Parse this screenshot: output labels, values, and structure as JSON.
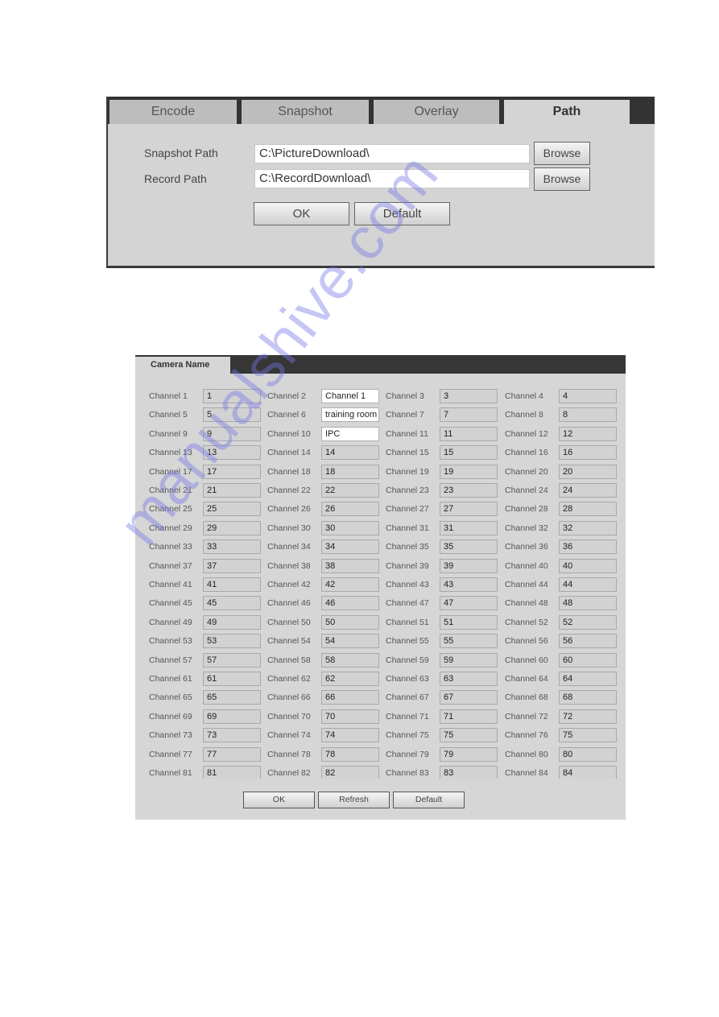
{
  "path_panel": {
    "tabs": [
      {
        "label": "Encode",
        "active": false
      },
      {
        "label": "Snapshot",
        "active": false
      },
      {
        "label": "Overlay",
        "active": false
      },
      {
        "label": "Path",
        "active": true
      }
    ],
    "snapshot_path": {
      "label": "Snapshot Path",
      "value": "C:\\PictureDownload\\",
      "browse_label": "Browse"
    },
    "record_path": {
      "label": "Record Path",
      "value": "C:\\RecordDownload\\",
      "browse_label": "Browse"
    },
    "ok_label": "OK",
    "default_label": "Default"
  },
  "camera_panel": {
    "tab_label": "Camera Name",
    "channels": [
      {
        "label": "Channel 1",
        "value": "1",
        "editable": false
      },
      {
        "label": "Channel 2",
        "value": "Channel 1",
        "editable": true
      },
      {
        "label": "Channel 3",
        "value": "3",
        "editable": false
      },
      {
        "label": "Channel 4",
        "value": "4",
        "editable": false
      },
      {
        "label": "Channel 5",
        "value": "5",
        "editable": false
      },
      {
        "label": "Channel 6",
        "value": "training room",
        "editable": true
      },
      {
        "label": "Channel 7",
        "value": "7",
        "editable": false
      },
      {
        "label": "Channel 8",
        "value": "8",
        "editable": false
      },
      {
        "label": "Channel 9",
        "value": "9",
        "editable": false
      },
      {
        "label": "Channel 10",
        "value": "IPC",
        "editable": true
      },
      {
        "label": "Channel 11",
        "value": "11",
        "editable": false
      },
      {
        "label": "Channel 12",
        "value": "12",
        "editable": false
      },
      {
        "label": "Channel 13",
        "value": "13",
        "editable": false
      },
      {
        "label": "Channel 14",
        "value": "14",
        "editable": false
      },
      {
        "label": "Channel 15",
        "value": "15",
        "editable": false
      },
      {
        "label": "Channel 16",
        "value": "16",
        "editable": false
      },
      {
        "label": "Channel 17",
        "value": "17",
        "editable": false
      },
      {
        "label": "Channel 18",
        "value": "18",
        "editable": false
      },
      {
        "label": "Channel 19",
        "value": "19",
        "editable": false
      },
      {
        "label": "Channel 20",
        "value": "20",
        "editable": false
      },
      {
        "label": "Channel 21",
        "value": "21",
        "editable": false
      },
      {
        "label": "Channel 22",
        "value": "22",
        "editable": false
      },
      {
        "label": "Channel 23",
        "value": "23",
        "editable": false
      },
      {
        "label": "Channel 24",
        "value": "24",
        "editable": false
      },
      {
        "label": "Channel 25",
        "value": "25",
        "editable": false
      },
      {
        "label": "Channel 26",
        "value": "26",
        "editable": false
      },
      {
        "label": "Channel 27",
        "value": "27",
        "editable": false
      },
      {
        "label": "Channel 28",
        "value": "28",
        "editable": false
      },
      {
        "label": "Channel 29",
        "value": "29",
        "editable": false
      },
      {
        "label": "Channel 30",
        "value": "30",
        "editable": false
      },
      {
        "label": "Channel 31",
        "value": "31",
        "editable": false
      },
      {
        "label": "Channel 32",
        "value": "32",
        "editable": false
      },
      {
        "label": "Channel 33",
        "value": "33",
        "editable": false
      },
      {
        "label": "Channel 34",
        "value": "34",
        "editable": false
      },
      {
        "label": "Channel 35",
        "value": "35",
        "editable": false
      },
      {
        "label": "Channel 36",
        "value": "36",
        "editable": false
      },
      {
        "label": "Channel 37",
        "value": "37",
        "editable": false
      },
      {
        "label": "Channel 38",
        "value": "38",
        "editable": false
      },
      {
        "label": "Channel 39",
        "value": "39",
        "editable": false
      },
      {
        "label": "Channel 40",
        "value": "40",
        "editable": false
      },
      {
        "label": "Channel 41",
        "value": "41",
        "editable": false
      },
      {
        "label": "Channel 42",
        "value": "42",
        "editable": false
      },
      {
        "label": "Channel 43",
        "value": "43",
        "editable": false
      },
      {
        "label": "Channel 44",
        "value": "44",
        "editable": false
      },
      {
        "label": "Channel 45",
        "value": "45",
        "editable": false
      },
      {
        "label": "Channel 46",
        "value": "46",
        "editable": false
      },
      {
        "label": "Channel 47",
        "value": "47",
        "editable": false
      },
      {
        "label": "Channel 48",
        "value": "48",
        "editable": false
      },
      {
        "label": "Channel 49",
        "value": "49",
        "editable": false
      },
      {
        "label": "Channel 50",
        "value": "50",
        "editable": false
      },
      {
        "label": "Channel 51",
        "value": "51",
        "editable": false
      },
      {
        "label": "Channel 52",
        "value": "52",
        "editable": false
      },
      {
        "label": "Channel 53",
        "value": "53",
        "editable": false
      },
      {
        "label": "Channel 54",
        "value": "54",
        "editable": false
      },
      {
        "label": "Channel 55",
        "value": "55",
        "editable": false
      },
      {
        "label": "Channel 56",
        "value": "56",
        "editable": false
      },
      {
        "label": "Channel 57",
        "value": "57",
        "editable": false
      },
      {
        "label": "Channel 58",
        "value": "58",
        "editable": false
      },
      {
        "label": "Channel 59",
        "value": "59",
        "editable": false
      },
      {
        "label": "Channel 60",
        "value": "60",
        "editable": false
      },
      {
        "label": "Channel 61",
        "value": "61",
        "editable": false
      },
      {
        "label": "Channel 62",
        "value": "62",
        "editable": false
      },
      {
        "label": "Channel 63",
        "value": "63",
        "editable": false
      },
      {
        "label": "Channel 64",
        "value": "64",
        "editable": false
      },
      {
        "label": "Channel 65",
        "value": "65",
        "editable": false
      },
      {
        "label": "Channel 66",
        "value": "66",
        "editable": false
      },
      {
        "label": "Channel 67",
        "value": "67",
        "editable": false
      },
      {
        "label": "Channel 68",
        "value": "68",
        "editable": false
      },
      {
        "label": "Channel 69",
        "value": "69",
        "editable": false
      },
      {
        "label": "Channel 70",
        "value": "70",
        "editable": false
      },
      {
        "label": "Channel 71",
        "value": "71",
        "editable": false
      },
      {
        "label": "Channel 72",
        "value": "72",
        "editable": false
      },
      {
        "label": "Channel 73",
        "value": "73",
        "editable": false
      },
      {
        "label": "Channel 74",
        "value": "74",
        "editable": false
      },
      {
        "label": "Channel 75",
        "value": "75",
        "editable": false
      },
      {
        "label": "Channel 76",
        "value": "75",
        "editable": false
      },
      {
        "label": "Channel 77",
        "value": "77",
        "editable": false
      },
      {
        "label": "Channel 78",
        "value": "78",
        "editable": false
      },
      {
        "label": "Channel 79",
        "value": "79",
        "editable": false
      },
      {
        "label": "Channel 80",
        "value": "80",
        "editable": false
      },
      {
        "label": "Channel 81",
        "value": "81",
        "editable": false
      },
      {
        "label": "Channel 82",
        "value": "82",
        "editable": false
      },
      {
        "label": "Channel 83",
        "value": "83",
        "editable": false
      },
      {
        "label": "Channel 84",
        "value": "84",
        "editable": false
      }
    ],
    "ok_label": "OK",
    "refresh_label": "Refresh",
    "default_label": "Default"
  },
  "watermark": "manualshive.com"
}
